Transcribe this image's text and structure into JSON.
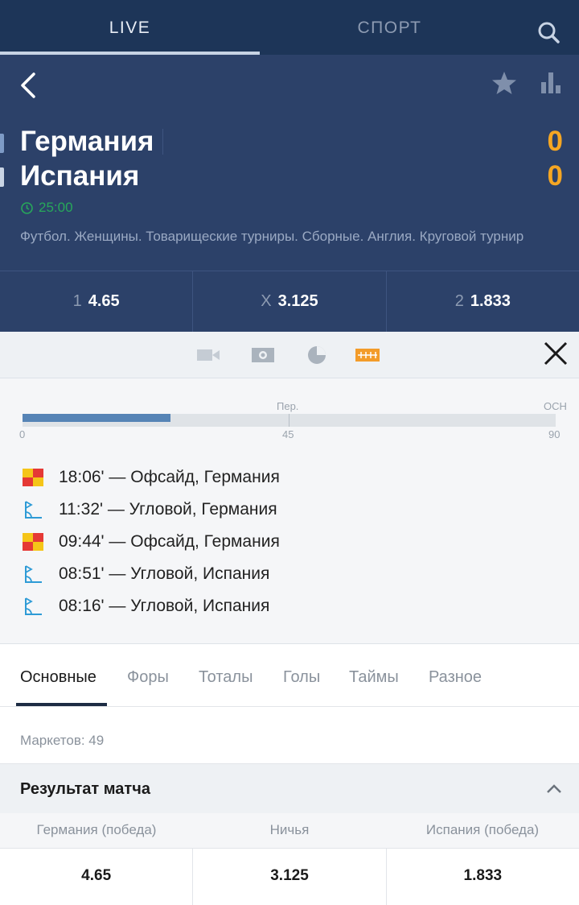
{
  "nav": {
    "tabs": [
      {
        "label": "LIVE",
        "active": true
      },
      {
        "label": "СПОРТ",
        "active": false
      }
    ],
    "search_icon": "search-icon"
  },
  "match": {
    "team1": "Германия",
    "team2": "Испания",
    "score1": "0",
    "score2": "0",
    "time": "25:00",
    "competition": "Футбол. Женщины. Товарищеские турниры. Сборные. Англия. Круговой турнир"
  },
  "odds": [
    {
      "label": "1",
      "value": "4.65"
    },
    {
      "label": "X",
      "value": "3.125"
    },
    {
      "label": "2",
      "value": "1.833"
    }
  ],
  "timeline": {
    "label_period": "Пер.",
    "label_end": "ОСН",
    "tick_start": "0",
    "tick_mid": "45",
    "tick_end": "90",
    "progress_minutes": 25,
    "total_minutes": 90,
    "events": [
      {
        "icon": "offside-icon",
        "text": "18:06' — Офсайд, Германия"
      },
      {
        "icon": "corner-icon",
        "text": "11:32' — Угловой, Германия"
      },
      {
        "icon": "offside-icon",
        "text": "09:44' — Офсайд, Германия"
      },
      {
        "icon": "corner-icon",
        "text": "08:51' — Угловой, Испания"
      },
      {
        "icon": "corner-icon",
        "text": "08:16' — Угловой, Испания"
      }
    ]
  },
  "market_tabs": [
    "Основные",
    "Форы",
    "Тоталы",
    "Голы",
    "Таймы",
    "Разное"
  ],
  "markets_count": "Маркетов: 49",
  "section": {
    "title": "Результат матча",
    "outcome_labels": [
      "Германия (победа)",
      "Ничья",
      "Испания (победа)"
    ],
    "outcome_values": [
      "4.65",
      "3.125",
      "1.833"
    ]
  },
  "colors": {
    "nav_bg": "#1d3558",
    "header_bg": "#2c4169",
    "score": "#f5a623",
    "timer": "#27a85a",
    "progress": "#5684b6",
    "corner": "#2e9bd6"
  }
}
